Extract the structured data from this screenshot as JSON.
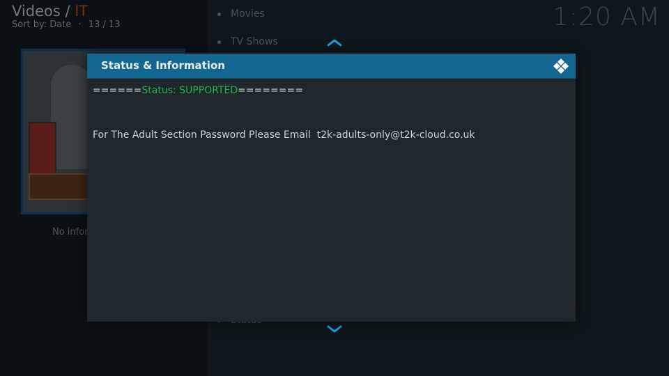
{
  "header": {
    "section": "Videos",
    "separator": "/",
    "folder": "IT",
    "sort_label": "Sort by: Date",
    "sort_dot": "·",
    "count": "13 / 13"
  },
  "clock": "1:20 AM",
  "info_panel": {
    "no_info_text": "No infor"
  },
  "menu": {
    "items": [
      {
        "label": "Movies"
      },
      {
        "label": "TV Shows"
      },
      {
        "label": "Status"
      }
    ]
  },
  "dialog": {
    "title": "Status & Information",
    "status_prefix": "======",
    "status_text": "Status: SUPPORTED",
    "status_suffix": "========",
    "message": "For The Adult Section Password Please Email  t2k-adults-only@t2k-cloud.co.uk"
  },
  "icons": {
    "up": "chevron-up-icon",
    "down": "chevron-down-icon",
    "brand": "kodi-logo-icon"
  },
  "colors": {
    "dialog_header": "#12668f",
    "status_ok": "#22b14c",
    "folder_accent": "#7a2a17",
    "chevron": "#12a5e0"
  }
}
